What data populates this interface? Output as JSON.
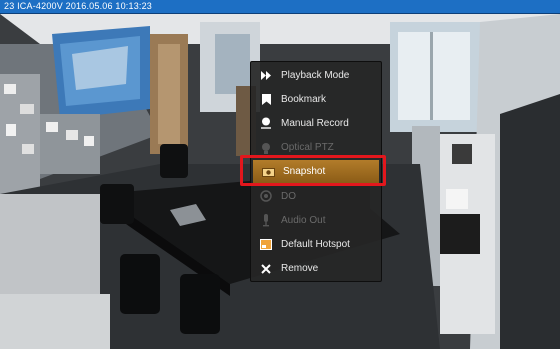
{
  "window": {
    "title": "23 ICA-4200V   2016.05.06 10:13:23"
  },
  "context_menu": {
    "items": [
      {
        "label": "Playback Mode",
        "icon": "fast-forward-icon",
        "enabled": true
      },
      {
        "label": "Bookmark",
        "icon": "bookmark-icon",
        "enabled": true
      },
      {
        "label": "Manual Record",
        "icon": "record-icon",
        "enabled": true
      },
      {
        "label": "Optical PTZ",
        "icon": "ptz-icon",
        "enabled": false
      },
      {
        "label": "Snapshot",
        "icon": "snapshot-icon",
        "enabled": true,
        "selected": true
      },
      {
        "label": "DO",
        "icon": "digital-output-icon",
        "enabled": false
      },
      {
        "label": "Audio Out",
        "icon": "microphone-icon",
        "enabled": false
      },
      {
        "label": "Default Hotspot",
        "icon": "hotspot-icon",
        "enabled": true
      },
      {
        "label": "Remove",
        "icon": "close-icon",
        "enabled": true
      }
    ],
    "highlight_color": "#e3171d",
    "selected_color": "#b27c2a"
  }
}
